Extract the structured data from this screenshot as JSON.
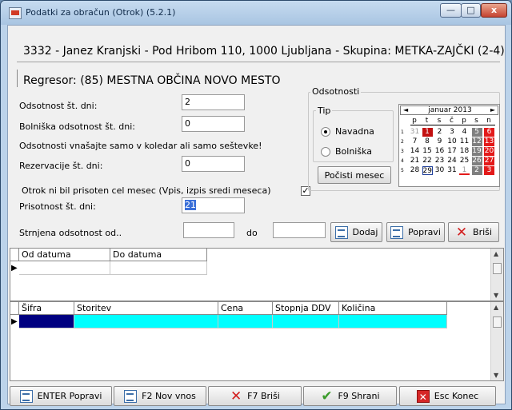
{
  "window": {
    "title": "Podatki za obračun (Otrok)  (5.2.1)",
    "min_glyph": "—",
    "max_glyph": "□",
    "close_glyph": "x"
  },
  "header": {
    "main": "3332 - Janez Kranjski - Pod Hribom 110, 1000 Ljubljana - Skupina: METKA-ZAJČKI (2-4)",
    "regresor": "Regresor: (85) MESTNA OBČINA NOVO MESTO"
  },
  "form": {
    "odsotnost_label": "Odsotnost št. dni:",
    "odsotnost_value": "2",
    "bolniska_label": "Bolniška odsotnost št. dni:",
    "bolniska_value": "0",
    "note": "Odsotnosti vnašajte samo v koledar ali samo seštevke!",
    "rezervacije_label": "Rezervacije št. dni:",
    "rezervacije_value": "0",
    "otrok_label": "Otrok ni bil prisoten cel mesec (Vpis,  izpis sredi meseca)",
    "otrok_checked": "✓",
    "prisotnost_label": "Prisotnost  št. dni:",
    "prisotnost_value": "21",
    "strnjena_label": "Strnjena odsotnost od..",
    "do_label": "do",
    "od_value": "",
    "do_value": ""
  },
  "odsotnosti": {
    "group_title": "Odsotnosti",
    "tip_title": "Tip",
    "radio_navadna": "Navadna",
    "radio_bolniska": "Bolniška",
    "selected": "Navadna",
    "pocisti_button": "Počisti mesec"
  },
  "calendar": {
    "month": "januar 2013",
    "prev": "◄",
    "next": "►",
    "weekdays": [
      "p",
      "t",
      "s",
      "č",
      "p",
      "s",
      "n"
    ],
    "weeks": [
      {
        "num": "1",
        "days": [
          "31",
          "1",
          "2",
          "3",
          "4",
          "5",
          "6"
        ]
      },
      {
        "num": "2",
        "days": [
          "7",
          "8",
          "9",
          "10",
          "11",
          "12",
          "13"
        ]
      },
      {
        "num": "3",
        "days": [
          "14",
          "15",
          "16",
          "17",
          "18",
          "19",
          "20"
        ]
      },
      {
        "num": "4",
        "days": [
          "21",
          "22",
          "23",
          "24",
          "25",
          "26",
          "27"
        ]
      },
      {
        "num": "5",
        "days": [
          "28",
          "29",
          "30",
          "31",
          "1",
          "2",
          "3"
        ]
      }
    ],
    "colors": {
      "absent": "#e31a1a",
      "weekend": "#7f7f7f",
      "selected": "#c21010"
    }
  },
  "actions": {
    "dodaj": "Dodaj",
    "popravi": "Popravi",
    "brisi": "Briši"
  },
  "grid1": {
    "columns": [
      "Od datuma",
      "Do datuma"
    ],
    "pointer": "▶"
  },
  "grid2": {
    "columns": [
      "Šifra",
      "Storitev",
      "Cena",
      "Stopnja DDV",
      "Količina"
    ],
    "pointer": "▶",
    "row_colors": {
      "first": "#000080",
      "rest": "#00ffff"
    }
  },
  "bottom": {
    "enter_popravi": "ENTER Popravi",
    "f2_nov": "F2 Nov vnos",
    "f7_brisi": "F7 Briši",
    "f9_shrani": "F9 Shrani",
    "esc_konec": "Esc Konec"
  }
}
